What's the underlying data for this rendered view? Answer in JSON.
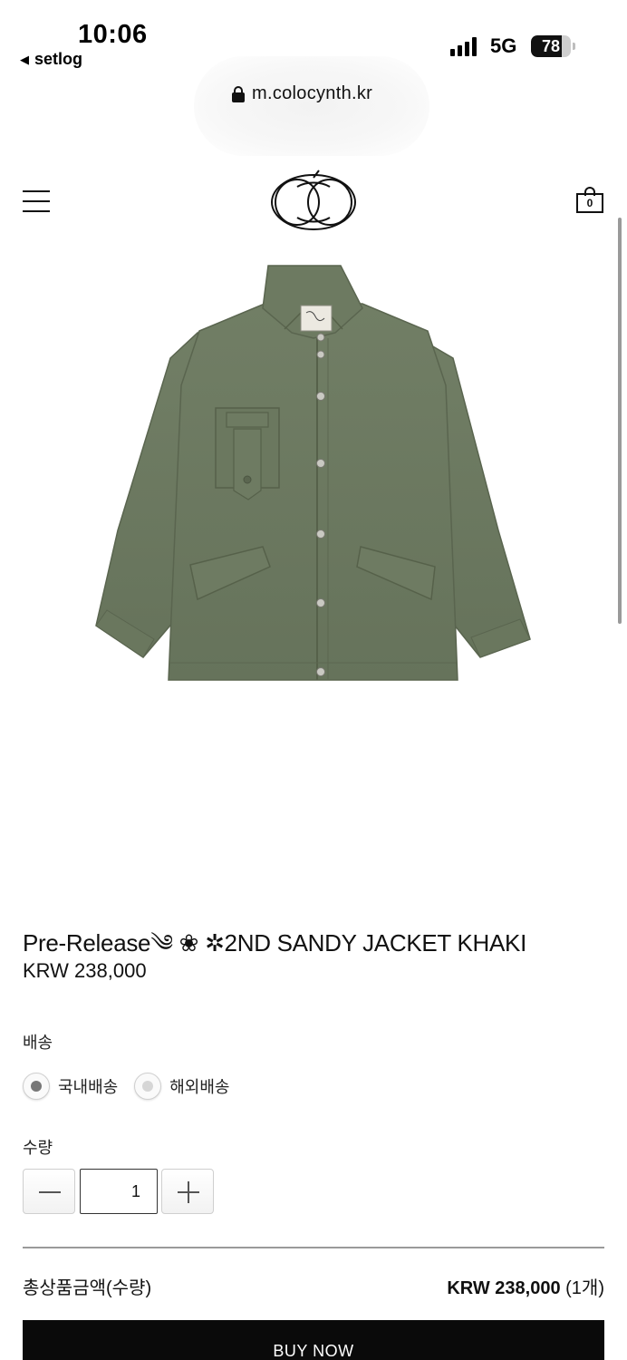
{
  "status_bar": {
    "time": "10:06",
    "back_app": "setlog",
    "network": "5G",
    "battery": "78",
    "battery_level": 0.78
  },
  "browser": {
    "url": "m.colocynth.kr"
  },
  "header": {
    "cart_count": "0",
    "menu_icon": "hamburger-menu-icon",
    "cart_icon": "shopping-bag-icon",
    "logo_icon": "colocynth-logo-icon"
  },
  "product": {
    "title": "Pre-Release༄ ❀ ✲2ND SANDY JACKET KHAKI",
    "price": "KRW 238,000",
    "image_color": "#6f7c62"
  },
  "options": {
    "shipping_label": "배송",
    "shipping_options": [
      {
        "label": "국내배송",
        "selected": true
      },
      {
        "label": "해외배송",
        "selected": false
      }
    ],
    "quantity_label": "수량",
    "quantity_value": "1"
  },
  "summary": {
    "total_label": "총상품금액(수량)",
    "total_amount": "KRW 238,000",
    "total_count": " (1개)"
  },
  "actions": {
    "buy_now": "BUY NOW"
  }
}
